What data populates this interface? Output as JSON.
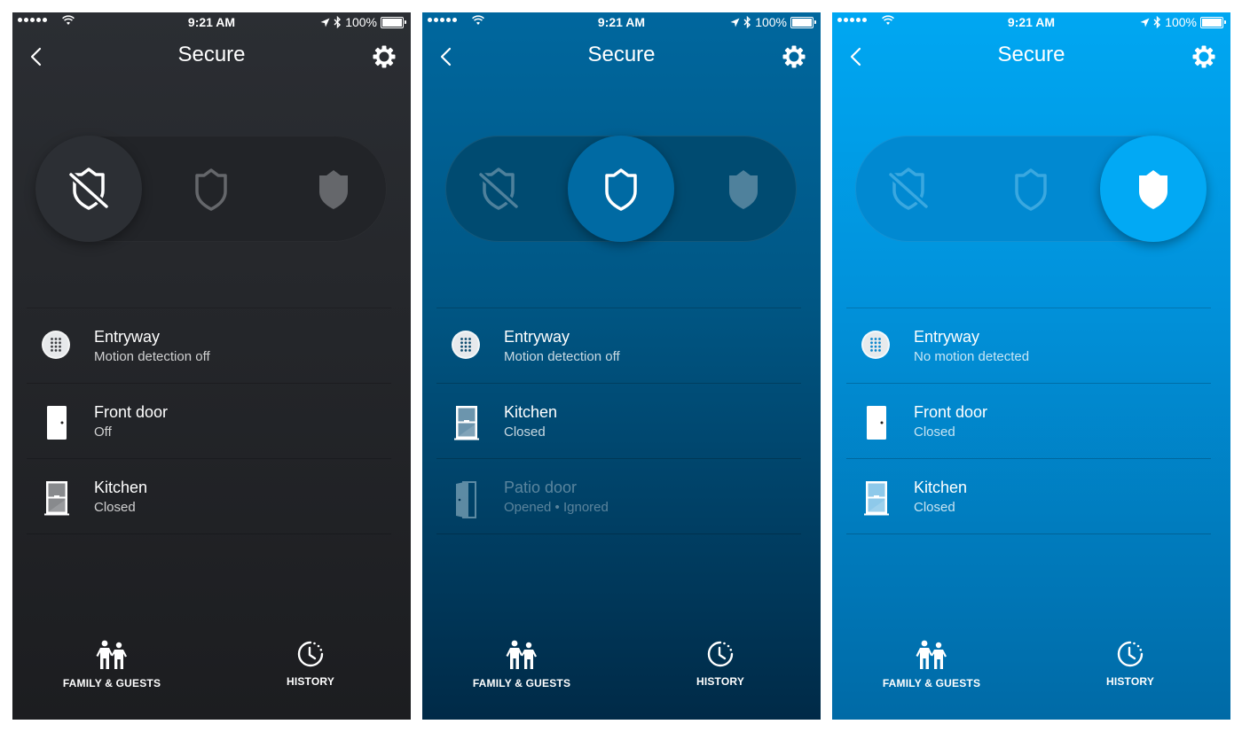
{
  "status_bar": {
    "time": "9:21 AM",
    "battery": "100%",
    "icons": [
      "signal-dots-icon",
      "wifi-icon",
      "location-arrow-icon",
      "bluetooth-icon",
      "battery-icon"
    ]
  },
  "screens": [
    {
      "theme": "dark",
      "background": "#25272b",
      "title": "Secure",
      "active_mode": "off",
      "modes": [
        {
          "id": "off",
          "icon": "shield-off-icon",
          "active": true
        },
        {
          "id": "home",
          "icon": "shield-outline-icon",
          "active": false
        },
        {
          "id": "away",
          "icon": "shield-filled-icon",
          "active": false
        }
      ],
      "devices": [
        {
          "icon": "motion-sensor-icon",
          "name": "Entryway",
          "status": "Motion detection off",
          "dimmed": false
        },
        {
          "icon": "door-icon",
          "name": "Front door",
          "status": "Off",
          "dimmed": false
        },
        {
          "icon": "window-icon",
          "name": "Kitchen",
          "status": "Closed",
          "dimmed": false
        }
      ],
      "tabs": [
        {
          "icon": "family-icon",
          "label": "FAMILY & GUESTS"
        },
        {
          "icon": "history-icon",
          "label": "HISTORY"
        }
      ]
    },
    {
      "theme": "blue-dark",
      "background": "#005785",
      "title": "Secure",
      "active_mode": "home",
      "modes": [
        {
          "id": "off",
          "icon": "shield-off-icon",
          "active": false
        },
        {
          "id": "home",
          "icon": "shield-outline-icon",
          "active": true
        },
        {
          "id": "away",
          "icon": "shield-filled-icon",
          "active": false
        }
      ],
      "devices": [
        {
          "icon": "motion-sensor-icon",
          "name": "Entryway",
          "status": "Motion detection off",
          "dimmed": false
        },
        {
          "icon": "window-icon",
          "name": "Kitchen",
          "status": "Closed",
          "dimmed": false
        },
        {
          "icon": "door-open-icon",
          "name": "Patio door",
          "status": "Opened • Ignored",
          "dimmed": true
        }
      ],
      "tabs": [
        {
          "icon": "family-icon",
          "label": "FAMILY & GUESTS"
        },
        {
          "icon": "history-icon",
          "label": "HISTORY"
        }
      ]
    },
    {
      "theme": "blue-bright",
      "background": "#0192db",
      "title": "Secure",
      "active_mode": "away",
      "modes": [
        {
          "id": "off",
          "icon": "shield-off-icon",
          "active": false
        },
        {
          "id": "home",
          "icon": "shield-outline-icon",
          "active": false
        },
        {
          "id": "away",
          "icon": "shield-filled-icon",
          "active": true
        }
      ],
      "devices": [
        {
          "icon": "motion-sensor-icon",
          "name": "Entryway",
          "status": "No motion detected",
          "dimmed": false
        },
        {
          "icon": "door-icon",
          "name": "Front door",
          "status": "Closed",
          "dimmed": false
        },
        {
          "icon": "window-icon",
          "name": "Kitchen",
          "status": "Closed",
          "dimmed": false
        }
      ],
      "tabs": [
        {
          "icon": "family-icon",
          "label": "FAMILY & GUESTS"
        },
        {
          "icon": "history-icon",
          "label": "HISTORY"
        }
      ]
    }
  ]
}
